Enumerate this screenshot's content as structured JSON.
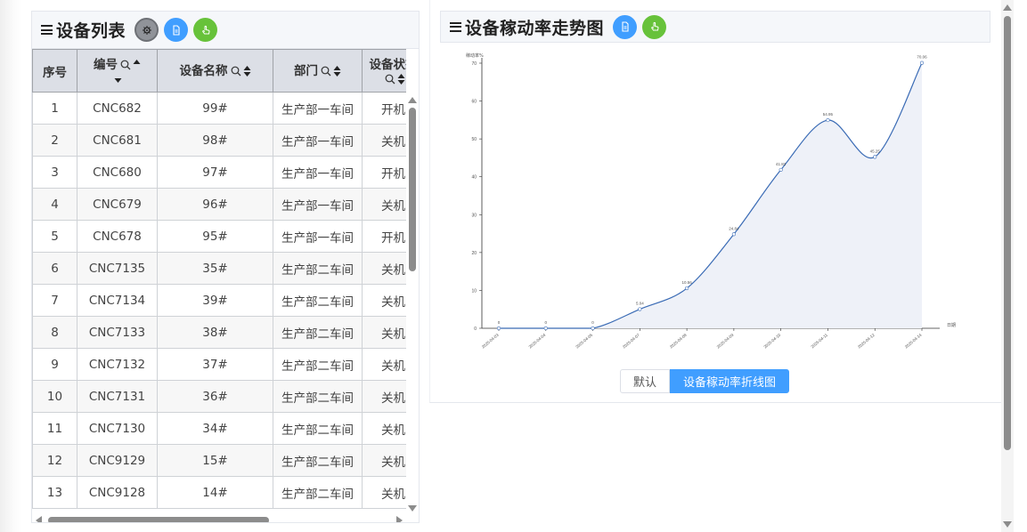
{
  "left_panel": {
    "title": "设备列表",
    "columns": [
      {
        "label": "序号"
      },
      {
        "label": "编号"
      },
      {
        "label": "设备名称"
      },
      {
        "label": "部门"
      },
      {
        "label": "设备状态"
      }
    ],
    "rows": [
      {
        "index": "1",
        "code": "CNC682",
        "name": "99#",
        "dept": "生产部一车间",
        "status": "开机"
      },
      {
        "index": "2",
        "code": "CNC681",
        "name": "98#",
        "dept": "生产部一车间",
        "status": "关机"
      },
      {
        "index": "3",
        "code": "CNC680",
        "name": "97#",
        "dept": "生产部一车间",
        "status": "开机"
      },
      {
        "index": "4",
        "code": "CNC679",
        "name": "96#",
        "dept": "生产部一车间",
        "status": "关机"
      },
      {
        "index": "5",
        "code": "CNC678",
        "name": "95#",
        "dept": "生产部一车间",
        "status": "开机"
      },
      {
        "index": "6",
        "code": "CNC7135",
        "name": "35#",
        "dept": "生产部二车间",
        "status": "关机"
      },
      {
        "index": "7",
        "code": "CNC7134",
        "name": "39#",
        "dept": "生产部二车间",
        "status": "关机"
      },
      {
        "index": "8",
        "code": "CNC7133",
        "name": "38#",
        "dept": "生产部二车间",
        "status": "关机"
      },
      {
        "index": "9",
        "code": "CNC7132",
        "name": "37#",
        "dept": "生产部二车间",
        "status": "关机"
      },
      {
        "index": "10",
        "code": "CNC7131",
        "name": "36#",
        "dept": "生产部二车间",
        "status": "关机"
      },
      {
        "index": "11",
        "code": "CNC7130",
        "name": "34#",
        "dept": "生产部二车间",
        "status": "关机"
      },
      {
        "index": "12",
        "code": "CNC9129",
        "name": "15#",
        "dept": "生产部二车间",
        "status": "关机"
      },
      {
        "index": "13",
        "code": "CNC9128",
        "name": "14#",
        "dept": "生产部二车间",
        "status": "关机"
      }
    ]
  },
  "right_panel": {
    "title": "设备稼动率走势图",
    "legend": {
      "default_label": "默认",
      "active_label": "设备稼动率折线图"
    }
  },
  "colors": {
    "line": "#3a6bb5",
    "area": "#eef1f8",
    "blue_button": "#409eff",
    "green_button": "#67c23a",
    "gray_button": "#909399"
  },
  "chart_data": {
    "type": "area",
    "ylabel": "稼动率%",
    "xlabel": "日期",
    "ylim": [
      0,
      70
    ],
    "yticks": [
      0,
      10,
      20,
      30,
      40,
      50,
      60,
      70
    ],
    "grid": false,
    "x": [
      "2025-04-03",
      "2025-04-04",
      "2025-04-05",
      "2025-04-07",
      "2025-04-08",
      "2025-04-09",
      "2025-04-10",
      "2025-04-11",
      "2025-04-12",
      "2025-04-14"
    ],
    "values": [
      0,
      0,
      0,
      5.04,
      10.56,
      24.84,
      41.83,
      54.95,
      45.25,
      70.06
    ],
    "data_labels": [
      "0",
      "0",
      "0",
      "5.04",
      "10.56",
      "24.84",
      "41.83",
      "54.95",
      "45.25",
      "70.06"
    ]
  }
}
